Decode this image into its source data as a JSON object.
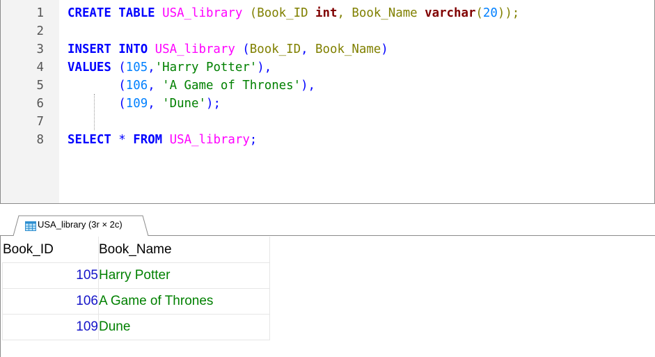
{
  "editor": {
    "lines": [
      {
        "n": "1",
        "tokens": [
          {
            "t": "CREATE TABLE",
            "c": "kw"
          },
          {
            "t": " ",
            "c": "ob"
          },
          {
            "t": "USA_library",
            "c": "tbl"
          },
          {
            "t": " (",
            "c": "col"
          },
          {
            "t": "Book_ID",
            "c": "col"
          },
          {
            "t": " ",
            "c": "ob"
          },
          {
            "t": "int",
            "c": "dt"
          },
          {
            "t": ", ",
            "c": "col"
          },
          {
            "t": "Book_Name",
            "c": "col"
          },
          {
            "t": " ",
            "c": "ob"
          },
          {
            "t": "varchar",
            "c": "dt"
          },
          {
            "t": "(",
            "c": "col"
          },
          {
            "t": "20",
            "c": "num"
          },
          {
            "t": "));",
            "c": "col"
          }
        ]
      },
      {
        "n": "2",
        "tokens": []
      },
      {
        "n": "3",
        "tokens": [
          {
            "t": "INSERT INTO",
            "c": "kw"
          },
          {
            "t": " ",
            "c": "ob"
          },
          {
            "t": "USA_library",
            "c": "tbl"
          },
          {
            "t": " (",
            "c": "pn"
          },
          {
            "t": "Book_ID",
            "c": "col"
          },
          {
            "t": ", ",
            "c": "pn"
          },
          {
            "t": "Book_Name",
            "c": "col"
          },
          {
            "t": ")",
            "c": "pn"
          }
        ]
      },
      {
        "n": "4",
        "tokens": [
          {
            "t": "VALUES",
            "c": "kw"
          },
          {
            "t": " (",
            "c": "pn"
          },
          {
            "t": "105",
            "c": "num"
          },
          {
            "t": ",",
            "c": "pn"
          },
          {
            "t": "'Harry Potter'",
            "c": "str"
          },
          {
            "t": "),",
            "c": "pn"
          }
        ]
      },
      {
        "n": "5",
        "tokens": [
          {
            "t": "       (",
            "c": "pn"
          },
          {
            "t": "106",
            "c": "num"
          },
          {
            "t": ", ",
            "c": "pn"
          },
          {
            "t": "'A Game of Thrones'",
            "c": "str"
          },
          {
            "t": "),",
            "c": "pn"
          }
        ]
      },
      {
        "n": "6",
        "tokens": [
          {
            "t": "       (",
            "c": "pn"
          },
          {
            "t": "109",
            "c": "num"
          },
          {
            "t": ", ",
            "c": "pn"
          },
          {
            "t": "'Dune'",
            "c": "str"
          },
          {
            "t": ");",
            "c": "pn"
          }
        ]
      },
      {
        "n": "7",
        "tokens": []
      },
      {
        "n": "8",
        "tokens": [
          {
            "t": "SELECT",
            "c": "kw"
          },
          {
            "t": " * ",
            "c": "pn"
          },
          {
            "t": "FROM",
            "c": "kw"
          },
          {
            "t": " ",
            "c": "ob"
          },
          {
            "t": "USA_library",
            "c": "tbl"
          },
          {
            "t": ";",
            "c": "pn"
          }
        ]
      }
    ]
  },
  "result_tab": {
    "label": "USA_library (3r × 2c)",
    "icon": "table-grid-icon"
  },
  "result_grid": {
    "columns": [
      "Book_ID",
      "Book_Name"
    ],
    "rows": [
      {
        "id": "105",
        "name": "Harry Potter"
      },
      {
        "id": "106",
        "name": "A Game of Thrones"
      },
      {
        "id": "109",
        "name": "Dune"
      }
    ]
  },
  "colors": {
    "keyword": "#0000ff",
    "datatype": "#800000",
    "table_name": "#ff00ff",
    "column_name": "#808000",
    "number": "#0080ff",
    "string": "#008000",
    "grid_id": "#1414c8",
    "grid_text": "#008000"
  }
}
